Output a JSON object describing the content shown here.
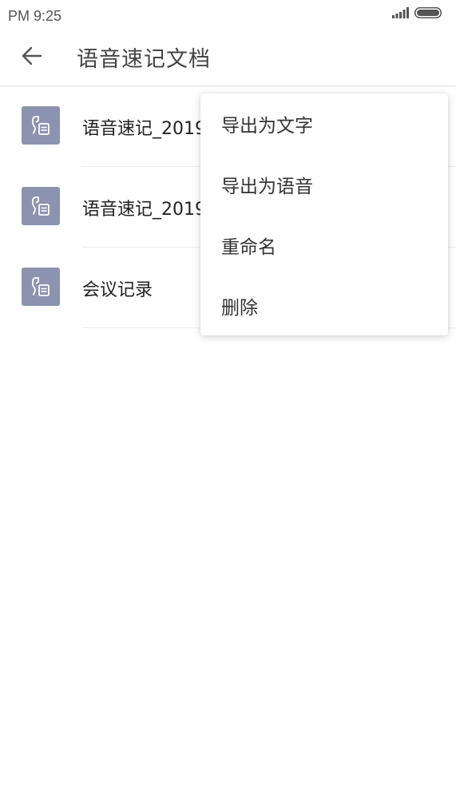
{
  "status_bar": {
    "time": "PM 9:25",
    "signal_icon": "signal-bars-icon",
    "battery_icon": "battery-icon"
  },
  "header": {
    "back_icon": "arrow-left-icon",
    "title": "语音速记文档"
  },
  "documents": [
    {
      "title": "语音速记_2019",
      "icon": "voice-doc-icon"
    },
    {
      "title": "语音速记_2019",
      "icon": "voice-doc-icon"
    },
    {
      "title": "会议记录",
      "icon": "voice-doc-icon"
    }
  ],
  "menu": {
    "items": [
      {
        "label": "导出为文字"
      },
      {
        "label": "导出为语音"
      },
      {
        "label": "重命名"
      },
      {
        "label": "删除"
      }
    ]
  },
  "colors": {
    "icon_background": "#8b93b0",
    "divider": "#ececec"
  }
}
